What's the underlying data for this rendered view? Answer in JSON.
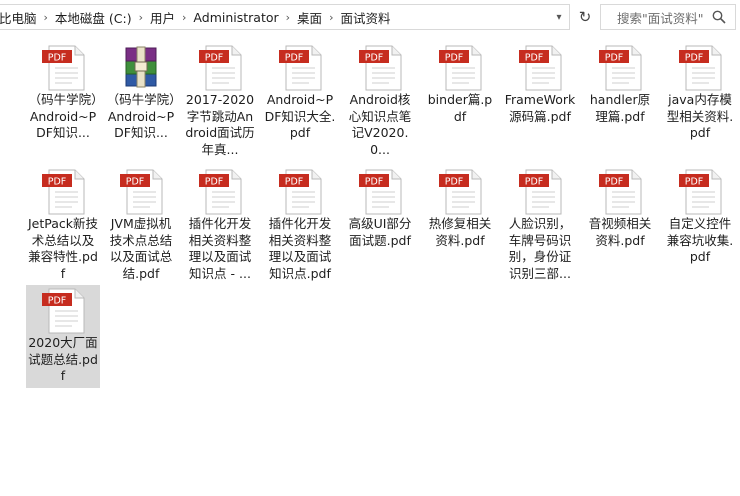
{
  "breadcrumb": {
    "items": [
      "比电脑",
      "本地磁盘 (C:)",
      "用户",
      "Administrator",
      "桌面",
      "面试资料"
    ]
  },
  "search": {
    "placeholder": "搜索\"面试资料\""
  },
  "icons": {
    "pdf_badge": "PDF"
  },
  "files": [
    {
      "type": "pdf",
      "label": "（码牛学院）Android~PDF知识..."
    },
    {
      "type": "rar",
      "label": "（码牛学院）Android~PDF知识..."
    },
    {
      "type": "pdf",
      "label": "2017-2020字节跳动Android面试历年真..."
    },
    {
      "type": "pdf",
      "label": "Android~PDF知识大全.pdf"
    },
    {
      "type": "pdf",
      "label": "Android核心知识点笔记V2020.0..."
    },
    {
      "type": "pdf",
      "label": "binder篇.pdf"
    },
    {
      "type": "pdf",
      "label": "FrameWork源码篇.pdf"
    },
    {
      "type": "pdf",
      "label": "handler原理篇.pdf"
    },
    {
      "type": "pdf",
      "label": "java内存模型相关资料.pdf"
    },
    {
      "type": "pdf",
      "label": "JetPack新技术总结以及兼容特性.pdf"
    },
    {
      "type": "pdf",
      "label": "JVM虚拟机技术点总结以及面试总结.pdf"
    },
    {
      "type": "pdf",
      "label": "插件化开发相关资料整理以及面试知识点 - ..."
    },
    {
      "type": "pdf",
      "label": "插件化开发相关资料整理以及面试知识点.pdf"
    },
    {
      "type": "pdf",
      "label": "高级UI部分面试题.pdf"
    },
    {
      "type": "pdf",
      "label": "热修复相关资料.pdf"
    },
    {
      "type": "pdf",
      "label": "人脸识别，车牌号码识别，身份证识别三部..."
    },
    {
      "type": "pdf",
      "label": "音视频相关资料.pdf"
    },
    {
      "type": "pdf",
      "label": "自定义控件兼容坑收集.pdf"
    },
    {
      "type": "pdf",
      "label": "2020大厂面试题总结.pdf",
      "selected": true
    }
  ]
}
